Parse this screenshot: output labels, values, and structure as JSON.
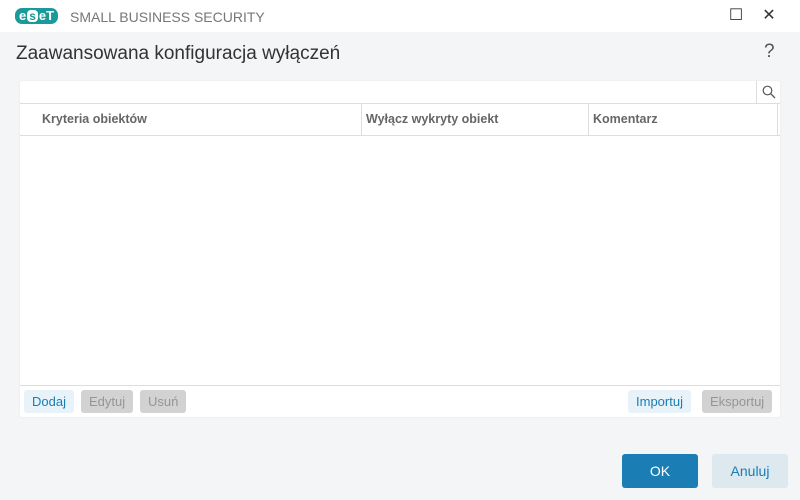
{
  "app": {
    "logo": "eset",
    "title": "SMALL BUSINESS SECURITY"
  },
  "dialog": {
    "title": "Zaawansowana konfiguracja wyłączeń",
    "help": "?"
  },
  "table": {
    "columns": [
      "Kryteria obiektów",
      "Wyłącz wykryty obiekt",
      "Komentarz"
    ],
    "rows": []
  },
  "actions": {
    "add": "Dodaj",
    "edit": "Edytuj",
    "remove": "Usuń",
    "import": "Importuj",
    "export": "Eksportuj"
  },
  "footer": {
    "ok": "OK",
    "cancel": "Anuluj"
  },
  "colors": {
    "accent": "#1a7db3",
    "brand": "#1a9a9a"
  }
}
